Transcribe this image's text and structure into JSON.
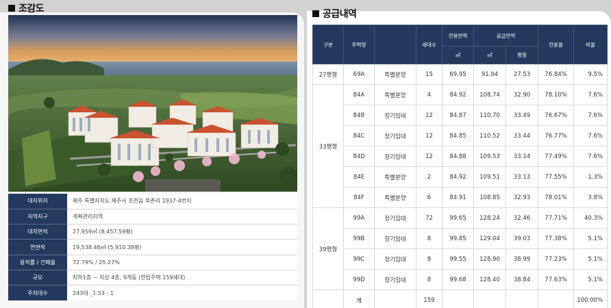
{
  "left": {
    "title": "조감도",
    "info_rows": [
      {
        "label": "대지위치",
        "value": "제주 특별자치도 제주시 조천읍 북촌리 1937-4번지"
      },
      {
        "label": "지역지구",
        "value": "계획관리지역"
      },
      {
        "label": "대지면적",
        "value": "27,959㎡ (8,457.59평)"
      },
      {
        "label": "연면적",
        "value": "19,538.46㎡ (5,910.38평)"
      },
      {
        "label": "용적률 / 건폐율",
        "value": "72.79% / 25.27%"
      },
      {
        "label": "규모",
        "value": "지하1층 ~ 지상 4층, 9개동 (연립주택 159세대)"
      },
      {
        "label": "주차대수",
        "value": "243대 _1.53 : 1"
      }
    ]
  },
  "right": {
    "title": "공급내역",
    "headers": {
      "group": "구분",
      "type": "주택형",
      "units": "세대수",
      "exclusive": "전용면적",
      "supply": "공급면적",
      "ratio_exclusive": "전용율",
      "ratio": "비율",
      "sqm": "㎡",
      "sqm2": "㎡",
      "pyeong": "평형"
    },
    "rows": [
      {
        "type": "69A",
        "kind": "특별분양",
        "units": "15",
        "excl": "69.95",
        "supply_sqm": "91.04",
        "pyeong": "27.53",
        "excl_rate": "76.84%",
        "ratio": "9.5%"
      },
      {
        "type": "84A",
        "kind": "특별분양",
        "units": "4",
        "excl": "84.92",
        "supply_sqm": "108.74",
        "pyeong": "32.90",
        "excl_rate": "78.10%",
        "ratio": "7.6%"
      },
      {
        "type": "84B",
        "kind": "장기임대",
        "units": "12",
        "excl": "84.87",
        "supply_sqm": "110.70",
        "pyeong": "33.49",
        "excl_rate": "76.67%",
        "ratio": "7.6%"
      },
      {
        "type": "84C",
        "kind": "장기임대",
        "units": "12",
        "excl": "84.85",
        "supply_sqm": "110.52",
        "pyeong": "33.44",
        "excl_rate": "76.77%",
        "ratio": "7.6%"
      },
      {
        "type": "84D",
        "kind": "장기임대",
        "units": "12",
        "excl": "84.88",
        "supply_sqm": "109.53",
        "pyeong": "33.14",
        "excl_rate": "77.49%",
        "ratio": "7.6%"
      },
      {
        "type": "84E",
        "kind": "특별분양",
        "units": "2",
        "excl": "84.92",
        "supply_sqm": "109.51",
        "pyeong": "33.13",
        "excl_rate": "77.55%",
        "ratio": "1.3%"
      },
      {
        "type": "84F",
        "kind": "특별분양",
        "units": "6",
        "excl": "84.91",
        "supply_sqm": "108.85",
        "pyeong": "32.93",
        "excl_rate": "78.01%",
        "ratio": "3.8%"
      },
      {
        "type": "99A",
        "kind": "장기임대",
        "units": "72",
        "excl": "99.65",
        "supply_sqm": "128.24",
        "pyeong": "32.46",
        "excl_rate": "77.71%",
        "ratio": "40.3%"
      },
      {
        "type": "99B",
        "kind": "장기임대",
        "units": "8",
        "excl": "99.85",
        "supply_sqm": "129.04",
        "pyeong": "39.03",
        "excl_rate": "77.38%",
        "ratio": "5.1%"
      },
      {
        "type": "99C",
        "kind": "장기임대",
        "units": "8",
        "excl": "99.55",
        "supply_sqm": "128.90",
        "pyeong": "38.99",
        "excl_rate": "77.23%",
        "ratio": "5.1%"
      },
      {
        "type": "99D",
        "kind": "장기임대",
        "units": "8",
        "excl": "99.68",
        "supply_sqm": "128.40",
        "pyeong": "38.84",
        "excl_rate": "77.63%",
        "ratio": "5.1%"
      }
    ],
    "groups": {
      "g27": "27평형",
      "g33": "33평형",
      "g39": "39평형"
    },
    "total": {
      "label": "계",
      "units": "159",
      "ratio": "100.00%"
    }
  }
}
